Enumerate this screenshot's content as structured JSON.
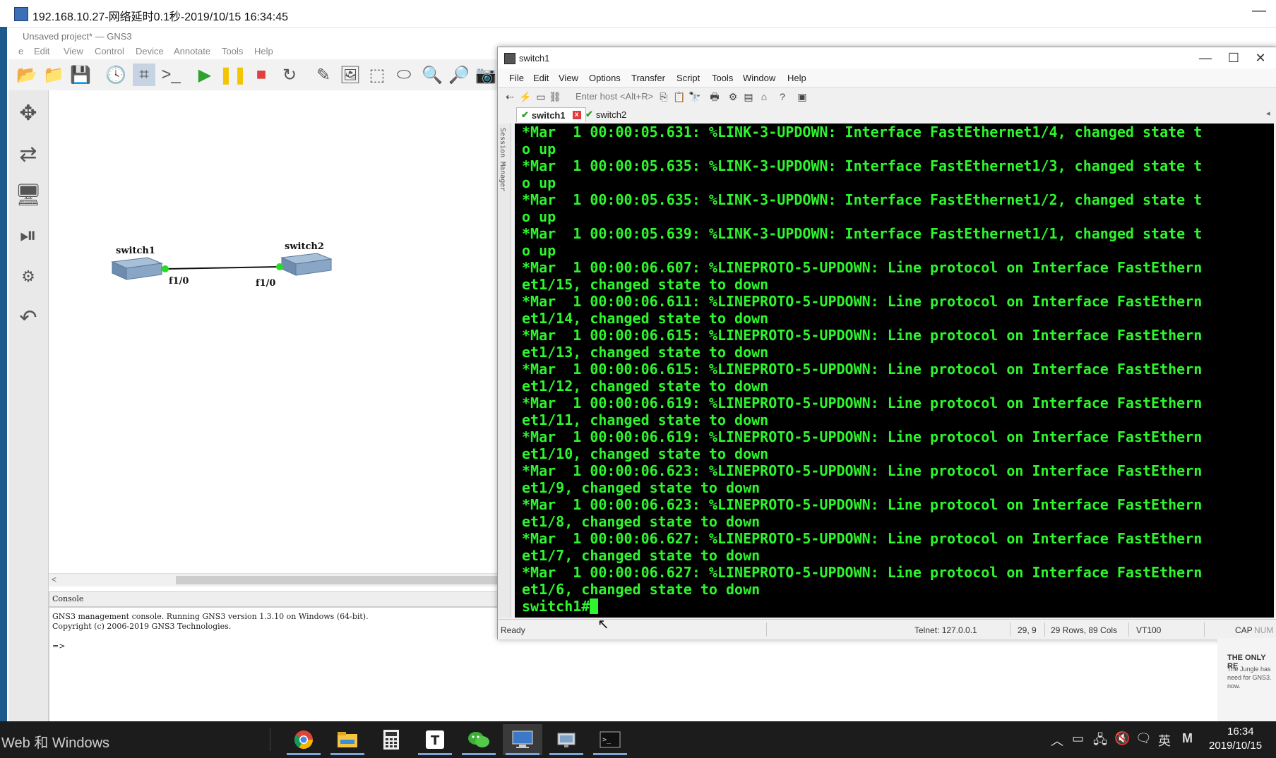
{
  "remote_window": {
    "title": "192.168.10.27-网络延时0.1秒-2019/10/15 16:34:45",
    "minimize_glyph": "—"
  },
  "gns3": {
    "title": "Unsaved project* — GNS3",
    "menu": [
      "e",
      "Edit",
      "View",
      "Control",
      "Device",
      "Annotate",
      "Tools",
      "Help"
    ],
    "devices": [
      {
        "name": "switch1",
        "port": "f1/0"
      },
      {
        "name": "switch2",
        "port": "f1/0"
      }
    ],
    "console": {
      "header": "Console",
      "lines": [
        "GNS3 management console. Running GNS3 version 1.3.10 on Windows (64-bit).",
        "Copyright (c) 2006-2019 GNS3 Technologies.",
        "",
        "=>"
      ]
    },
    "scroll_left_glyph": "<"
  },
  "crt": {
    "title": "switch1",
    "menu": [
      "File",
      "Edit",
      "View",
      "Options",
      "Transfer",
      "Script",
      "Tools",
      "Window",
      "Help"
    ],
    "host_placeholder": "Enter host <Alt+R>",
    "tabs": [
      {
        "label": "switch1",
        "active": true,
        "connected": true
      },
      {
        "label": "switch2",
        "active": false,
        "connected": true
      }
    ],
    "tab_close_glyph": "x",
    "session_manager_label": "Session Manager",
    "terminal_color": "#2ef52e",
    "terminal_lines": [
      "*Mar  1 00:00:05.631: %LINK-3-UPDOWN: Interface FastEthernet1/4, changed state t",
      "o up",
      "*Mar  1 00:00:05.635: %LINK-3-UPDOWN: Interface FastEthernet1/3, changed state t",
      "o up",
      "*Mar  1 00:00:05.635: %LINK-3-UPDOWN: Interface FastEthernet1/2, changed state t",
      "o up",
      "*Mar  1 00:00:05.639: %LINK-3-UPDOWN: Interface FastEthernet1/1, changed state t",
      "o up",
      "*Mar  1 00:00:06.607: %LINEPROTO-5-UPDOWN: Line protocol on Interface FastEthern",
      "et1/15, changed state to down",
      "*Mar  1 00:00:06.611: %LINEPROTO-5-UPDOWN: Line protocol on Interface FastEthern",
      "et1/14, changed state to down",
      "*Mar  1 00:00:06.615: %LINEPROTO-5-UPDOWN: Line protocol on Interface FastEthern",
      "et1/13, changed state to down",
      "*Mar  1 00:00:06.615: %LINEPROTO-5-UPDOWN: Line protocol on Interface FastEthern",
      "et1/12, changed state to down",
      "*Mar  1 00:00:06.619: %LINEPROTO-5-UPDOWN: Line protocol on Interface FastEthern",
      "et1/11, changed state to down",
      "*Mar  1 00:00:06.619: %LINEPROTO-5-UPDOWN: Line protocol on Interface FastEthern",
      "et1/10, changed state to down",
      "*Mar  1 00:00:06.623: %LINEPROTO-5-UPDOWN: Line protocol on Interface FastEthern",
      "et1/9, changed state to down",
      "*Mar  1 00:00:06.623: %LINEPROTO-5-UPDOWN: Line protocol on Interface FastEthern",
      "et1/8, changed state to down",
      "*Mar  1 00:00:06.627: %LINEPROTO-5-UPDOWN: Line protocol on Interface FastEthern",
      "et1/7, changed state to down",
      "*Mar  1 00:00:06.627: %LINEPROTO-5-UPDOWN: Line protocol on Interface FastEthern",
      "et1/6, changed state to down"
    ],
    "prompt": "switch1#",
    "status": {
      "ready": "Ready",
      "telnet": "Telnet: 127.0.0.1",
      "cursor_pos": "29,  9",
      "size": "29 Rows, 89 Cols",
      "emulation": "VT100",
      "cap": "CAP",
      "num": "NUM"
    }
  },
  "ad": {
    "heading": "THE ONLY RE",
    "text": "The Jungle has need for GNS3. now."
  },
  "taskbar": {
    "search": "Web 和 Windows",
    "apps": [
      "chrome-icon",
      "file-explorer-icon",
      "calculator-icon",
      "typora-icon",
      "wechat-icon",
      "remote-desktop-icon",
      "network-icon",
      "terminal-icon"
    ],
    "tray": {
      "ime": "英",
      "letter": "M",
      "time": "16:34",
      "date": "2019/10/15"
    }
  }
}
